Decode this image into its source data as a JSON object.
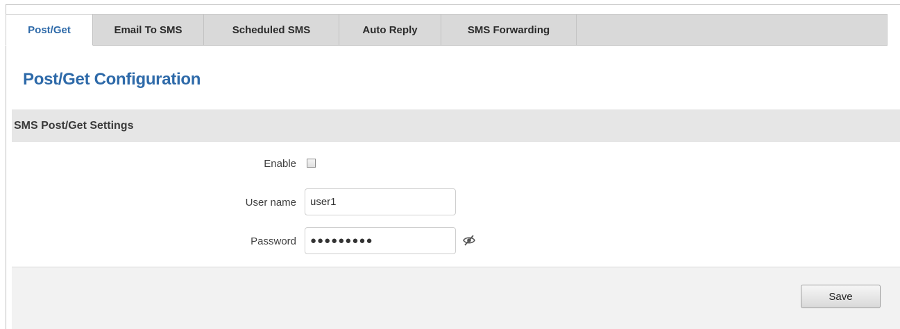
{
  "tabs": [
    {
      "label": "Post/Get",
      "active": true
    },
    {
      "label": "Email To SMS",
      "active": false
    },
    {
      "label": "Scheduled SMS",
      "active": false
    },
    {
      "label": "Auto Reply",
      "active": false
    },
    {
      "label": "SMS Forwarding",
      "active": false
    }
  ],
  "page_title": "Post/Get Configuration",
  "section": {
    "title": "SMS Post/Get Settings",
    "fields": {
      "enable": {
        "label": "Enable",
        "checked": false
      },
      "username": {
        "label": "User name",
        "value": "user1"
      },
      "password": {
        "label": "Password",
        "value": "●●●●●●●●●",
        "toggle_icon": "eye-slash-icon"
      }
    }
  },
  "footer": {
    "save_label": "Save"
  },
  "colors": {
    "accent": "#2e6aa9",
    "tab_bg": "#d9d9d9",
    "section_bg": "#e6e6e6",
    "footer_bg": "#f2f2f2"
  }
}
